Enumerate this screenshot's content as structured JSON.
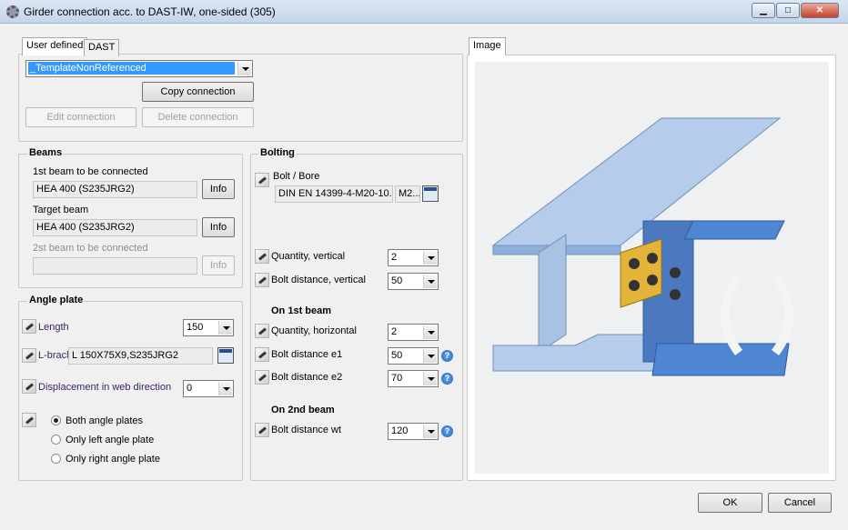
{
  "window": {
    "title": "Girder connection acc. to DAST-IW, one-sided (305)",
    "minimize": "▁",
    "maximize": "□",
    "close": "✕"
  },
  "tabs": {
    "user_defined": "User defined",
    "dast": "DAST"
  },
  "template": {
    "selected": "_TemplateNonReferenced",
    "copy": "Copy connection",
    "edit": "Edit connection",
    "delete": "Delete connection"
  },
  "beams": {
    "title": "Beams",
    "first_label": "1st beam to be connected",
    "first_value": "HEA 400  (S235JRG2)",
    "target_label": "Target beam",
    "target_value": "HEA 400  (S235JRG2)",
    "second_label": "2st beam to be connected",
    "second_value": "",
    "info": "Info"
  },
  "angle_plate": {
    "title": "Angle plate",
    "length_label": "Length",
    "length_value": "150",
    "lbrac_label": "L-bracl",
    "lbrac_value": "L 150X75X9,S235JRG2",
    "disp_label": "Displacement in web direction",
    "disp_value": "0",
    "options": [
      "Both angle plates",
      "Only left angle plate",
      "Only right angle plate"
    ],
    "selected_option": 0
  },
  "bolting": {
    "title": "Bolting",
    "bolt_label": "Bolt / Bore",
    "bolt_value": "DIN  EN 14399-4-M20-10...",
    "bore_value": "M2...",
    "qty_v_label": "Quantity, vertical",
    "qty_v": "2",
    "dist_v_label": "Bolt distance, vertical",
    "dist_v": "50",
    "first_beam": "On 1st beam",
    "qty_h_label": "Quantity, horizontal",
    "qty_h": "2",
    "e1_label": "Bolt distance e1",
    "e1": "50",
    "e2_label": "Bolt distance e2",
    "e2": "70",
    "second_beam": "On 2nd beam",
    "wt_label": "Bolt distance wt",
    "wt": "120",
    "help": "?"
  },
  "image_tab": "Image",
  "footer": {
    "ok": "OK",
    "cancel": "Cancel"
  }
}
